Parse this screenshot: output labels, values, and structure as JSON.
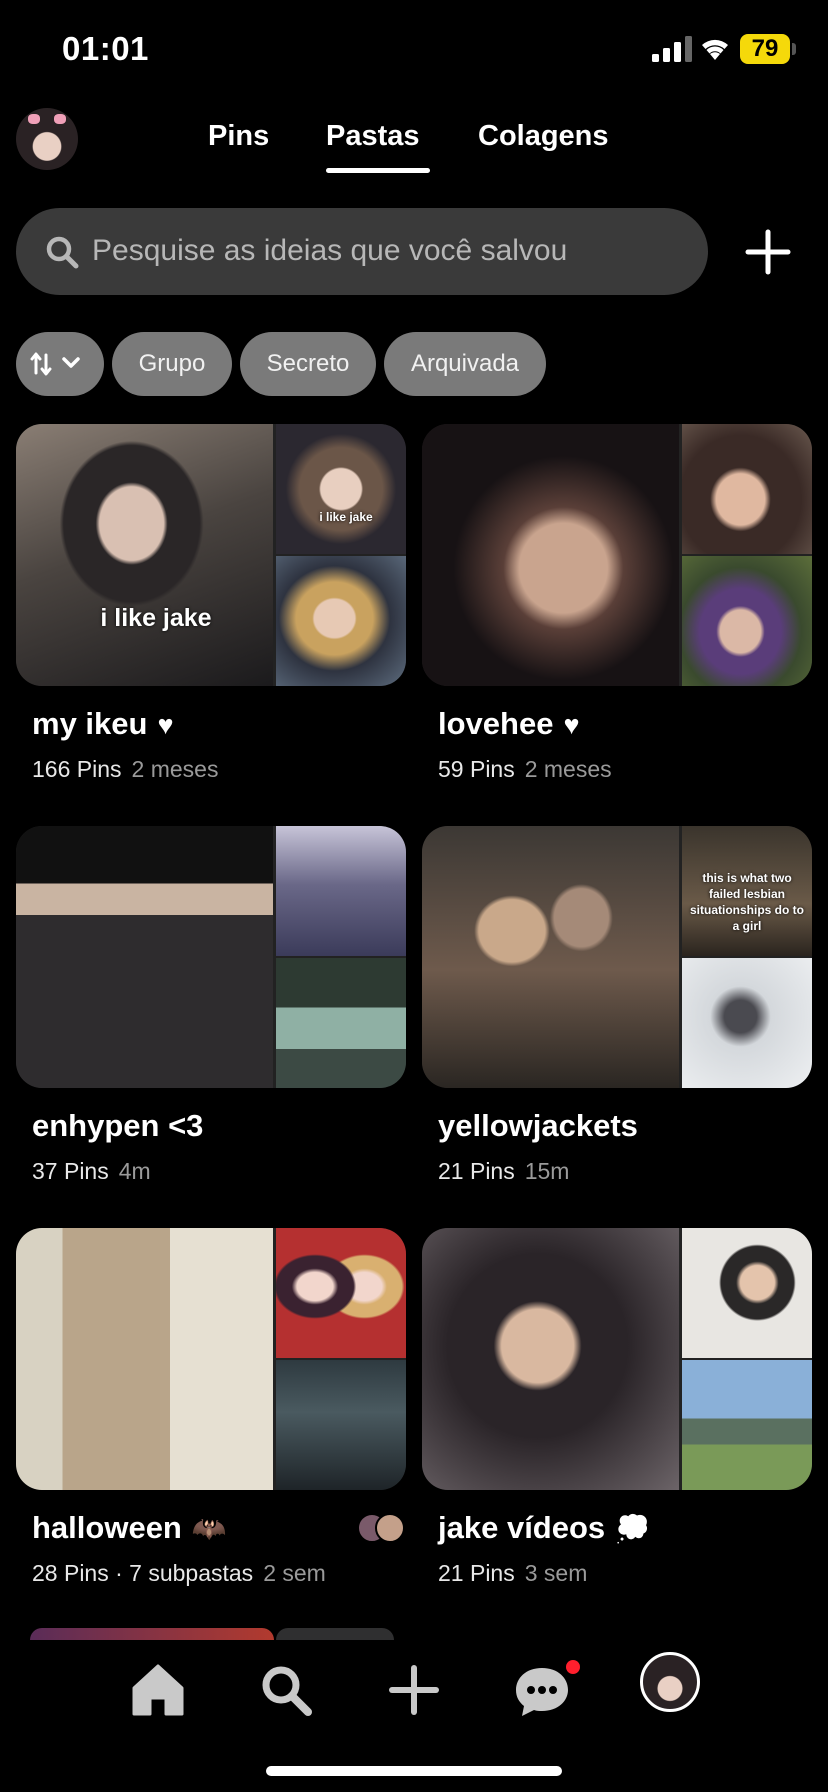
{
  "status_bar": {
    "time": "01:01",
    "battery": "79"
  },
  "header": {
    "tabs": [
      {
        "label": "Pins"
      },
      {
        "label": "Pastas"
      },
      {
        "label": "Colagens"
      }
    ],
    "active_tab": "Pastas"
  },
  "search": {
    "placeholder": "Pesquise as ideias que você salvou"
  },
  "filters": [
    {
      "label": "Grupo"
    },
    {
      "label": "Secreto"
    },
    {
      "label": "Arquivada"
    }
  ],
  "boards": [
    {
      "title": "my ikeu",
      "title_icon": "heart-icon",
      "count": "166 Pins",
      "age": "2 meses",
      "main_caption": "i like jake",
      "side_caption": "i like jake"
    },
    {
      "title": "lovehee",
      "title_icon": "heart-icon",
      "count": "59 Pins",
      "age": "2 meses"
    },
    {
      "title": "enhypen <3",
      "count": "37 Pins",
      "age": "4m"
    },
    {
      "title": "yellowjackets",
      "count": "21 Pins",
      "age": "15m",
      "side_caption": "this is what two failed lesbian situationships do to a girl"
    },
    {
      "title": "halloween",
      "title_icon": "bat-icon",
      "count": "28 Pins · 7 subpastas",
      "age": "2 sem"
    },
    {
      "title": "jake vídeos",
      "title_icon": "thought-bubble-icon",
      "count": "21 Pins",
      "age": "3 sem"
    }
  ],
  "colors": {
    "background": "#000000",
    "chip": "#7a7a7a",
    "search_bg": "#3a3a3a",
    "notification": "#ff1f2d",
    "battery": "#f5d90a"
  }
}
